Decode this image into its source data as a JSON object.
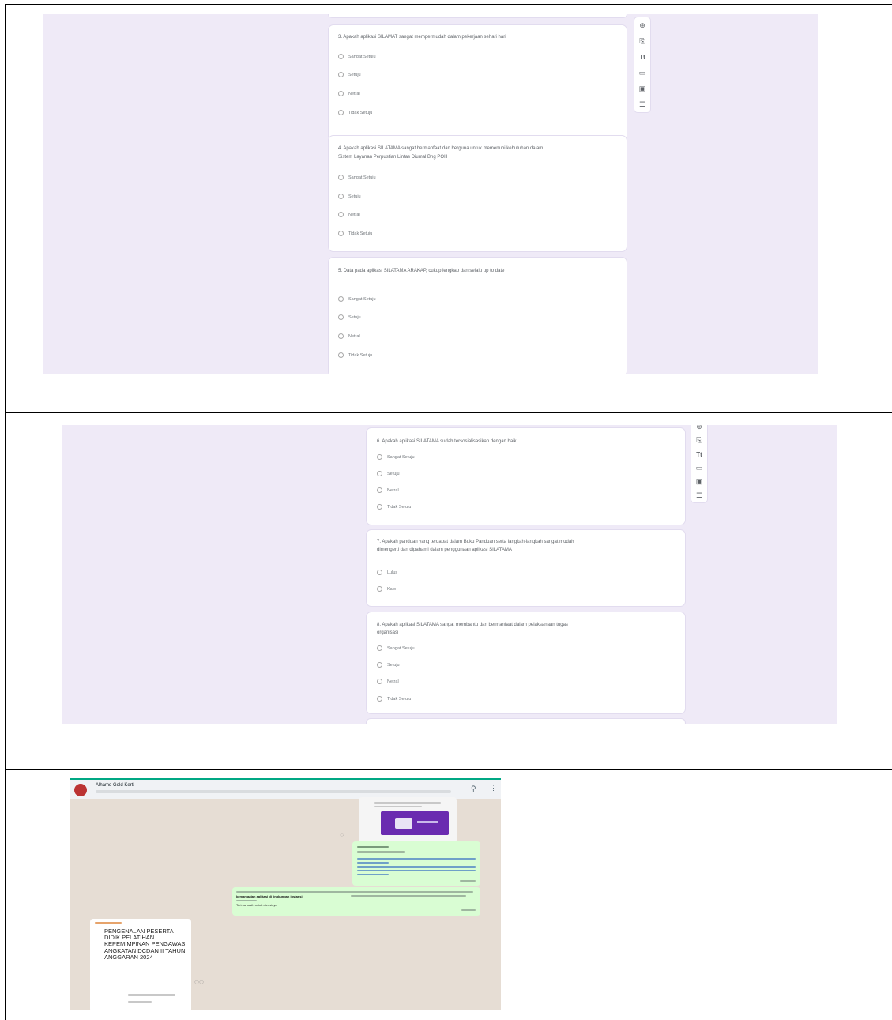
{
  "options_likert": [
    "Sangat Setuju",
    "Setuju",
    "Netral",
    "Tidak Setuju"
  ],
  "options_yesno": [
    "Lulus",
    "Kalo"
  ],
  "screenshot_1": {
    "q3": "3. Apakah aplikasi SILAMAT sangat mempermudah dalam pekerjaan sehari hari",
    "q4_line1": "4. Apakah aplikasi SILATAMA sangat bermanfaat dan berguna untuk memenuhi kebutuhan dalam",
    "q4_line2": "Sistem Layanan Perpustian Lintas Diumal Bng POH",
    "q5": "5. Data pada aplikasi SILATAMA ARAKAP, cukup lengkap dan selalu up to date"
  },
  "screenshot_2": {
    "q6": "6. Apakah aplikasi SILATAMA sudah tersosialisasikan dengan baik",
    "q7_line1": "7. Apakah panduan yang terdapat dalam Buku Panduan serta langkah-langkah sangat mudah",
    "q7_line2": "dimengerti dan dipahami dalam penggunaan aplikasi SILATAMA",
    "q8_line1": "8. Apakah aplikasi SILATAMA sangat membantu dan bermanfaat dalam pelaksanaan tugas",
    "q8_line2": "organisasi"
  },
  "screenshot_3": {
    "chat_title": "Alhamd Gold Kerti",
    "poster_text": "PENGENALAN PESERTA DIDIK PELATIHAN KEPEMIMPINAN PENGAWAS ANGKATAN DCDAN II TAHUN ANGGARAN 2024",
    "message_bold": "kemanfaatan aplikasi di lingkungan instansi",
    "message_end": "Terima kasih untuk atensinya"
  },
  "icons": [
    "add-circle-icon",
    "import-icon",
    "title-icon",
    "image-icon",
    "video-icon",
    "section-icon"
  ]
}
